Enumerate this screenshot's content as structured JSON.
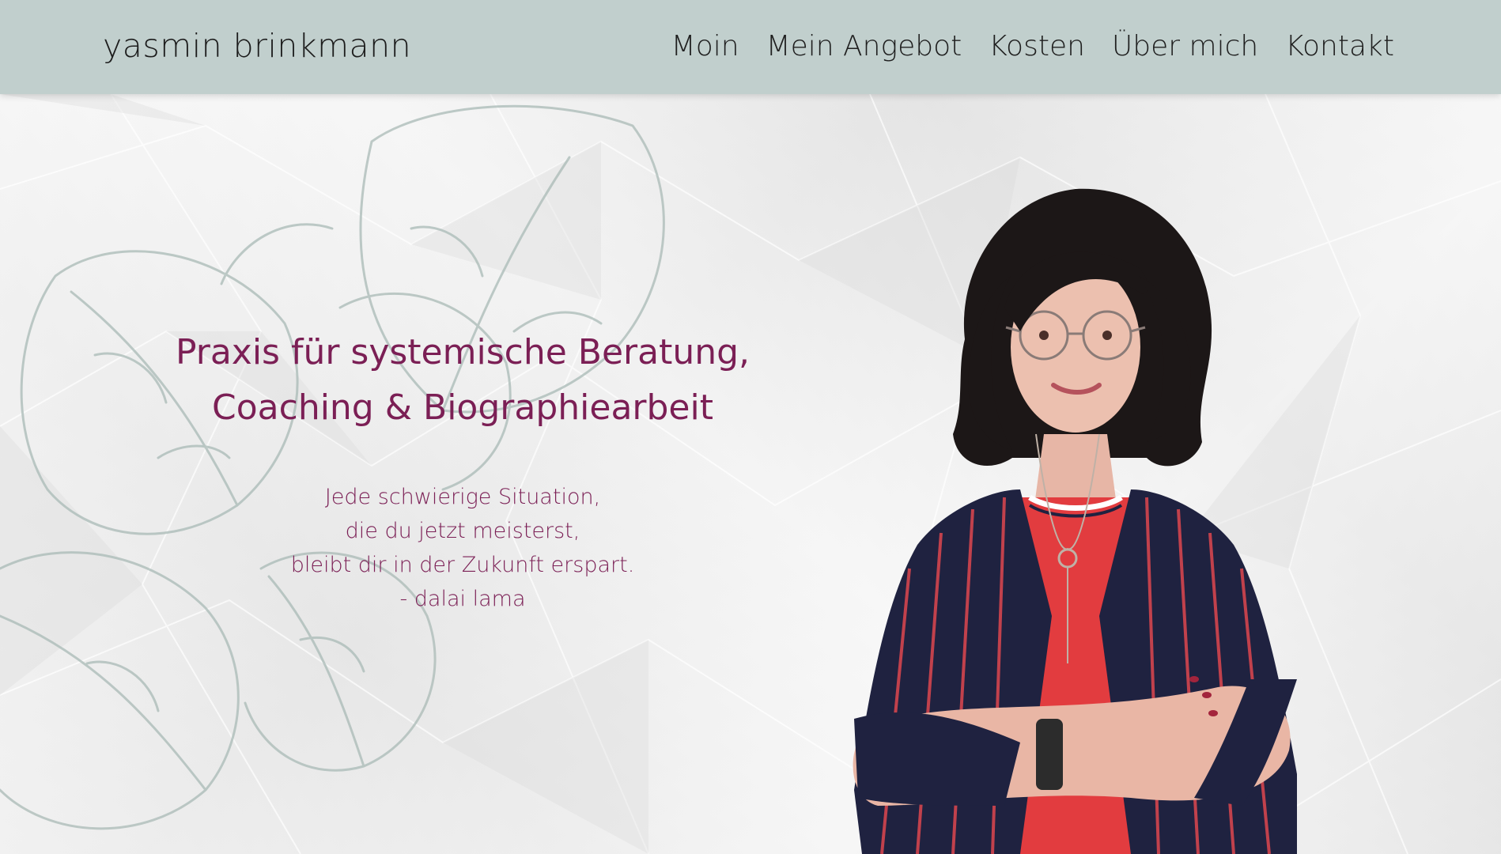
{
  "header": {
    "logo": "yasmin brinkmann",
    "nav": [
      {
        "label": "Moin"
      },
      {
        "label": "Mein Angebot"
      },
      {
        "label": "Kosten"
      },
      {
        "label": "Über mich"
      },
      {
        "label": "Kontakt"
      }
    ]
  },
  "hero": {
    "title_lines": [
      "Praxis für systemische Beratung,",
      "Coaching & Biographiearbeit"
    ],
    "quote_lines": [
      "Jede schwierige Situation,",
      "die du jetzt meisterst,",
      "bleibt dir in der Zukunft erspart.",
      "- dalai lama"
    ]
  },
  "colors": {
    "header_bg": "#c1cfcd",
    "accent": "#7b1f55",
    "leaf_line": "#a9bab6"
  }
}
